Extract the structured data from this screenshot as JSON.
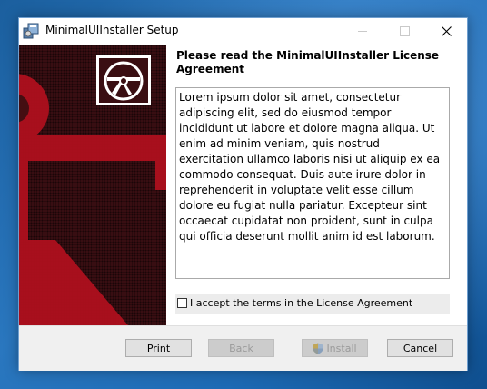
{
  "window": {
    "title": "MinimalUIInstaller Setup",
    "controls": {
      "minimize": "minimize-icon",
      "maximize": "maximize-icon",
      "close": "close-icon"
    }
  },
  "banner": {
    "icons": [
      "anchor-icon",
      "disc-icon"
    ],
    "colors": {
      "background": "#3a0e12",
      "anchor": "#b2101e",
      "frame": "#ffffff"
    }
  },
  "page": {
    "heading": "Please read the MinimalUIInstaller License Agreement",
    "license_text": "Lorem ipsum dolor sit amet, consectetur adipiscing elit, sed do eiusmod tempor incididunt ut labore et dolore magna aliqua. Ut enim ad minim veniam, quis nostrud exercitation ullamco laboris nisi ut aliquip ex ea commodo consequat. Duis aute irure dolor in reprehenderit in voluptate velit esse cillum dolore eu fugiat nulla pariatur. Excepteur sint occaecat cupidatat non proident, sunt in culpa qui officia deserunt mollit anim id est laborum.",
    "accept_label": "I accept the terms in the License Agreement",
    "accept_checked": false
  },
  "buttons": {
    "print": "Print",
    "back": "Back",
    "install": "Install",
    "cancel": "Cancel"
  }
}
